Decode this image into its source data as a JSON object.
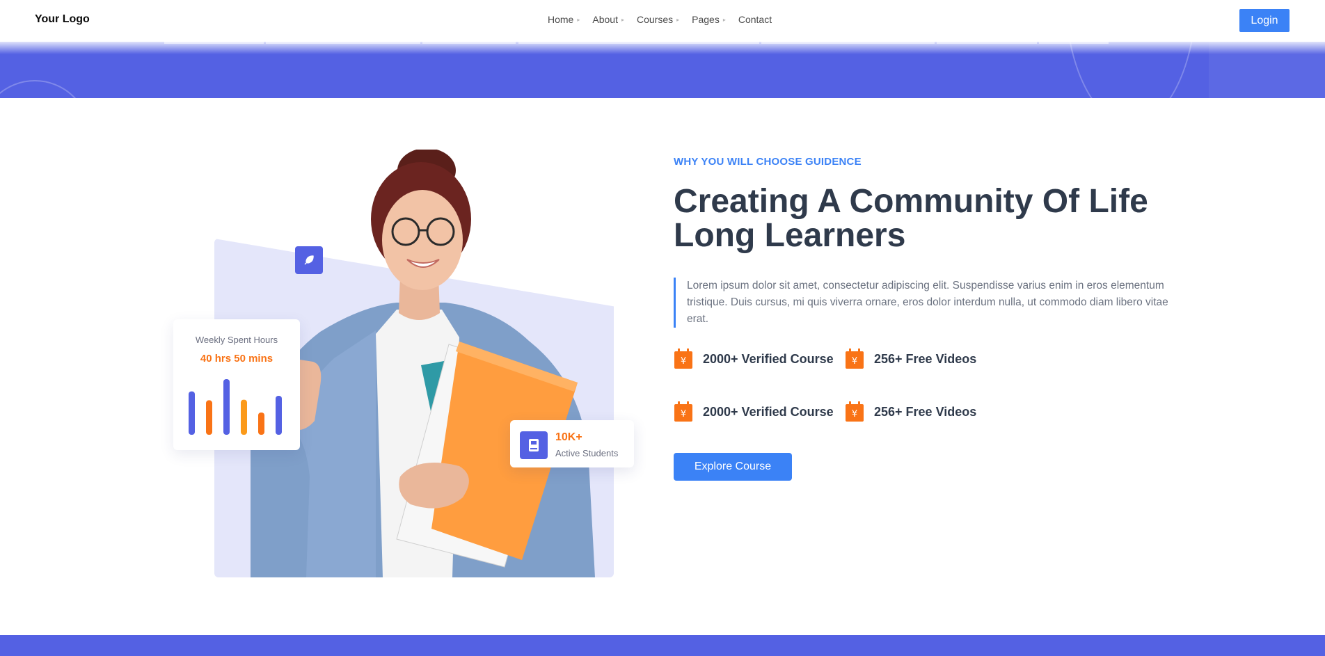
{
  "header": {
    "logo": "Your Logo",
    "nav": [
      {
        "label": "Home",
        "has_dropdown": true
      },
      {
        "label": "About",
        "has_dropdown": true
      },
      {
        "label": "Courses",
        "has_dropdown": true
      },
      {
        "label": "Pages",
        "has_dropdown": true
      },
      {
        "label": "Contact",
        "has_dropdown": false
      }
    ],
    "login_label": "Login"
  },
  "hero": {
    "eyebrow": "WHY YOU WILL CHOOSE GUIDENCE",
    "headline_line1": "Creating A Community Of Life",
    "headline_line2": "Long Learners",
    "description": "Lorem ipsum dolor sit amet, consectetur adipiscing elit. Suspendisse varius enim in eros elementum tristique. Duis cursus, mi quis viverra ornare, eros dolor interdum nulla, ut commodo diam libero vitae erat.",
    "features": [
      {
        "icon": "price-tag-icon",
        "label": "2000+ Verified Course"
      },
      {
        "icon": "price-tag-icon",
        "label": "256+ Free Videos"
      },
      {
        "icon": "price-tag-icon",
        "label": "2000+ Verified Course"
      },
      {
        "icon": "price-tag-icon",
        "label": "256+ Free Videos"
      }
    ],
    "cta_label": "Explore Course"
  },
  "weekly_card": {
    "title": "Weekly Spent Hours",
    "value": "40 hrs 50 mins",
    "bars": [
      {
        "value": 0.78,
        "color": "#5461e3"
      },
      {
        "value": 0.62,
        "color": "#f97316"
      },
      {
        "value": 1.0,
        "color": "#5461e3"
      },
      {
        "value": 0.63,
        "color": "#fb9a1a"
      },
      {
        "value": 0.4,
        "color": "#f97316"
      },
      {
        "value": 0.7,
        "color": "#5461e3"
      }
    ]
  },
  "students_card": {
    "count": "10K+",
    "label": "Active Students",
    "icon": "book-icon"
  },
  "colors": {
    "primary_blue": "#3b82f6",
    "band_indigo": "#5461e3",
    "accent_orange": "#f97316",
    "heading": "#2f3a4b"
  }
}
